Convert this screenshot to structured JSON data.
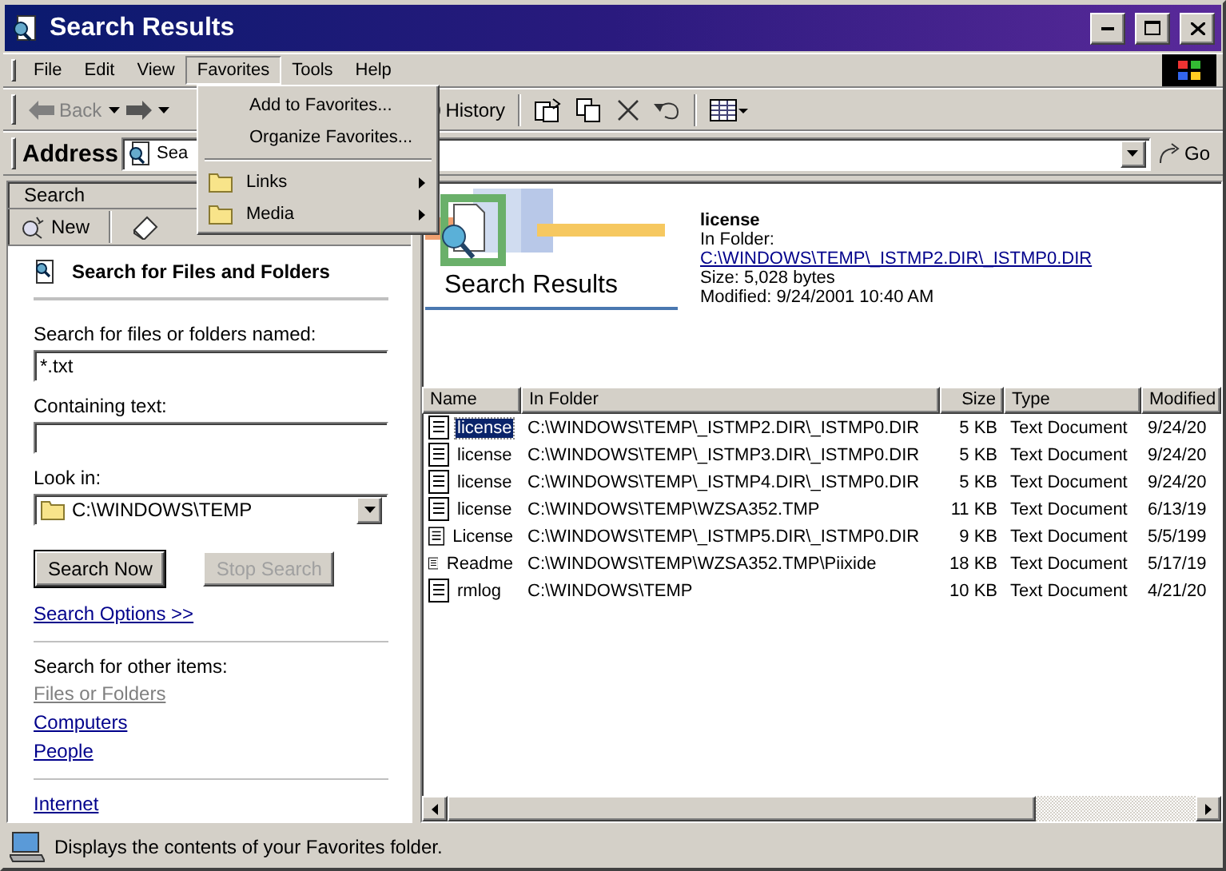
{
  "window": {
    "title": "Search Results"
  },
  "menu_bar": [
    {
      "label": "File",
      "selected": false
    },
    {
      "label": "Edit",
      "selected": false
    },
    {
      "label": "View",
      "selected": false
    },
    {
      "label": "Favorites",
      "selected": true
    },
    {
      "label": "Tools",
      "selected": false
    },
    {
      "label": "Help",
      "selected": false
    }
  ],
  "favorites_menu": [
    {
      "kind": "command",
      "label": "Add to Favorites..."
    },
    {
      "kind": "command",
      "label": "Organize Favorites..."
    },
    {
      "kind": "separator"
    },
    {
      "kind": "submenu",
      "label": "Links"
    },
    {
      "kind": "submenu",
      "label": "Media"
    }
  ],
  "toolbar": {
    "back": {
      "label": "Back",
      "disabled": true
    },
    "history": {
      "label": "History"
    }
  },
  "address_bar": {
    "label": "Address",
    "value": "Sea",
    "go": "Go"
  },
  "search_pane": {
    "title": "Search",
    "new_button": "New",
    "heading": "Search for Files and Folders",
    "named_label": "Search for files or folders named:",
    "named_value": "*.txt",
    "containing_label": "Containing text:",
    "look_in_label": "Look in:",
    "look_in_value": "C:\\WINDOWS\\TEMP",
    "buttons": [
      {
        "label": "Search Now",
        "disabled": false
      },
      {
        "label": "Stop Search",
        "disabled": true
      }
    ],
    "options_link": "Search Options  >>",
    "other_label": "Search for other items:",
    "other_links": [
      {
        "label": "Files or Folders",
        "disabled": true
      },
      {
        "label": "Computers",
        "disabled": false
      },
      {
        "label": "People",
        "disabled": false
      }
    ],
    "internet_link": "Internet"
  },
  "details": {
    "banner": "Search Results",
    "name": "license",
    "folder_label": "In Folder:",
    "folder_link": "C:\\WINDOWS\\TEMP\\_ISTMP2.DIR\\_ISTMP0.DIR",
    "size": "Size: 5,028 bytes",
    "modified": "Modified: 9/24/2001 10:40 AM"
  },
  "results": {
    "columns": [
      "Name",
      "In Folder",
      "Size",
      "Type",
      "Modified"
    ],
    "rows": [
      {
        "name": "license",
        "folder": "C:\\WINDOWS\\TEMP\\_ISTMP2.DIR\\_ISTMP0.DIR",
        "size": "5 KB",
        "type": "Text Document",
        "modified": "9/24/20",
        "selected": true
      },
      {
        "name": "license",
        "folder": "C:\\WINDOWS\\TEMP\\_ISTMP3.DIR\\_ISTMP0.DIR",
        "size": "5 KB",
        "type": "Text Document",
        "modified": "9/24/20",
        "selected": false
      },
      {
        "name": "license",
        "folder": "C:\\WINDOWS\\TEMP\\_ISTMP4.DIR\\_ISTMP0.DIR",
        "size": "5 KB",
        "type": "Text Document",
        "modified": "9/24/20",
        "selected": false
      },
      {
        "name": "license",
        "folder": "C:\\WINDOWS\\TEMP\\WZSA352.TMP",
        "size": "11 KB",
        "type": "Text Document",
        "modified": "6/13/19",
        "selected": false
      },
      {
        "name": "License",
        "folder": "C:\\WINDOWS\\TEMP\\_ISTMP5.DIR\\_ISTMP0.DIR",
        "size": "9 KB",
        "type": "Text Document",
        "modified": "5/5/199",
        "selected": false
      },
      {
        "name": "Readme",
        "folder": "C:\\WINDOWS\\TEMP\\WZSA352.TMP\\Piixide",
        "size": "18 KB",
        "type": "Text Document",
        "modified": "5/17/19",
        "selected": false
      },
      {
        "name": "rmlog",
        "folder": "C:\\WINDOWS\\TEMP",
        "size": "10 KB",
        "type": "Text Document",
        "modified": "4/21/20",
        "selected": false
      }
    ]
  },
  "status_bar": {
    "text": "Displays the contents of your Favorites folder."
  }
}
